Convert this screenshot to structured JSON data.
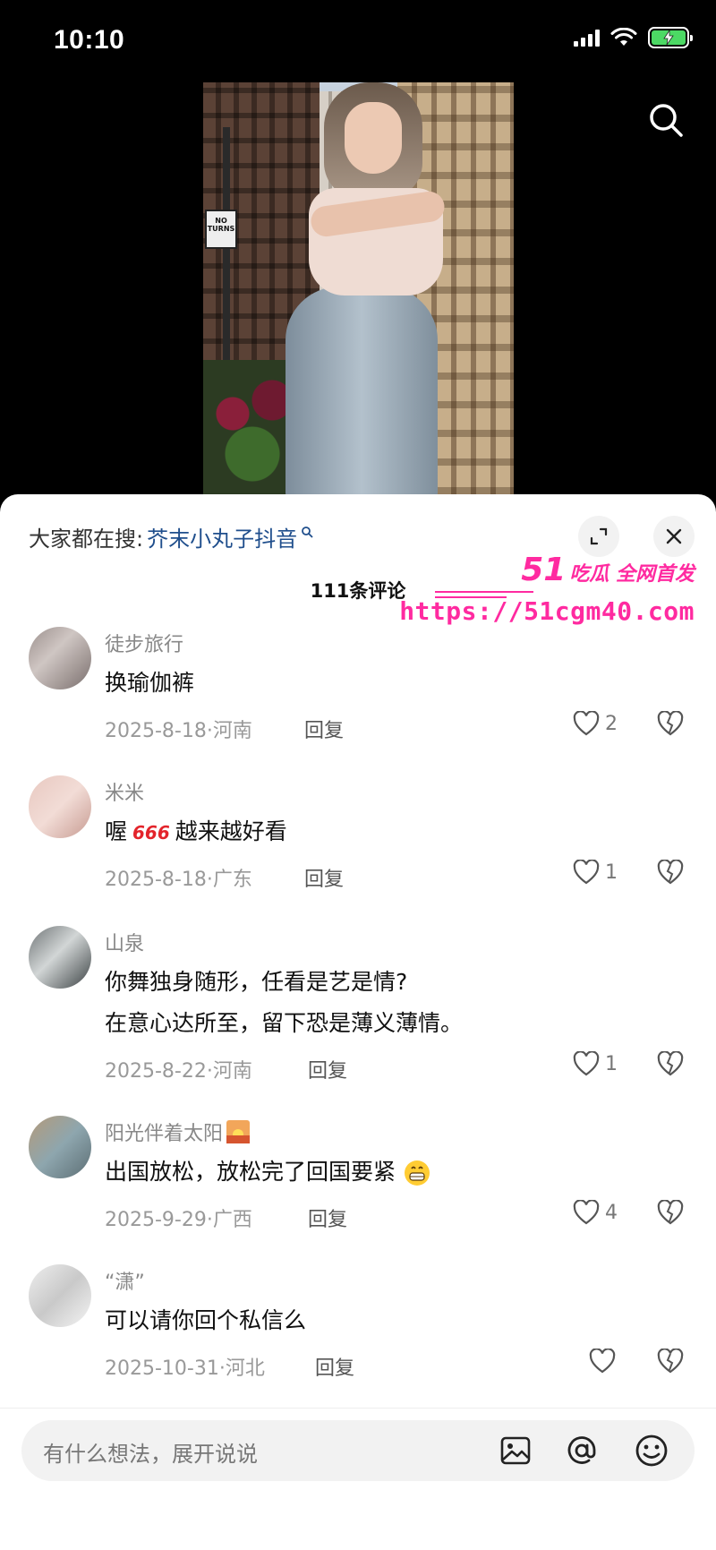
{
  "status_bar": {
    "time": "10:10"
  },
  "video": {
    "sign_text": "NO TURNS"
  },
  "search_suggest": {
    "prefix": "大家都在搜:",
    "keyword": "芥末小丸子抖音"
  },
  "comments_header": {
    "count_label": "111条评论"
  },
  "watermark": {
    "brand": "51",
    "tagline": "吃瓜 全网首发",
    "url": "https://51cgm40.com"
  },
  "comments": [
    {
      "name": "徒步旅行",
      "text": "换瑜伽裤",
      "meta": "2025-8-18·河南",
      "reply": "回复",
      "likes": "2"
    },
    {
      "name": "米米",
      "text_before": "喔",
      "emoji": "666",
      "text_after": "越来越好看",
      "meta": "2025-8-18·广东",
      "reply": "回复",
      "likes": "1"
    },
    {
      "name": "山泉",
      "line1": "你舞独身随形，任看是艺是情?",
      "line2": "在意心达所至，留下恐是薄义薄情。",
      "meta": "2025-8-22·河南",
      "reply": "回复",
      "likes": "1"
    },
    {
      "name": "阳光伴着太阳",
      "text": "出国放松，放松完了回国要紧",
      "meta": "2025-9-29·广西",
      "reply": "回复",
      "likes": "4"
    },
    {
      "name": "“潇”",
      "text": "可以请你回个私信么",
      "meta": "2025-10-31·河北",
      "reply": "回复",
      "likes": ""
    }
  ],
  "input": {
    "placeholder": "有什么想法，展开说说"
  },
  "colors": {
    "accent_link": "#1f4e8c",
    "watermark_pink": "#ff2aa0",
    "battery_green": "#4cd964"
  }
}
